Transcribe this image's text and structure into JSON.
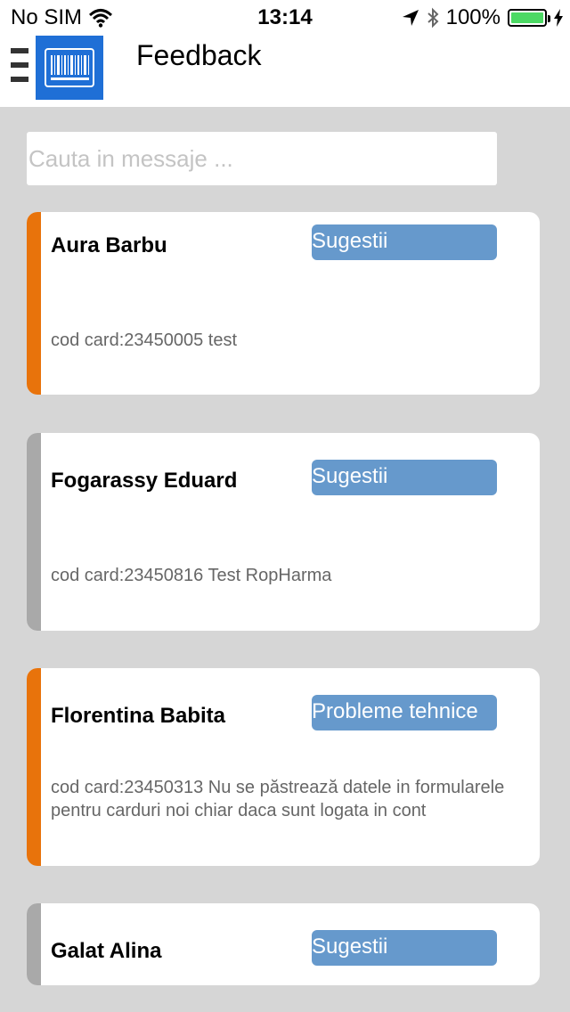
{
  "status_bar": {
    "carrier": "No SIM",
    "time": "13:14",
    "battery": "100%",
    "icons": [
      "wifi-icon",
      "location-arrow-icon",
      "bluetooth-icon",
      "battery-icon",
      "charging-bolt-icon"
    ]
  },
  "header": {
    "title": "Feedback",
    "menu_icon": "hamburger-menu-icon",
    "logo_icon": "barcode-card-icon"
  },
  "search": {
    "placeholder": "Cauta in messaje ..."
  },
  "colors": {
    "accent_orange": "#e8730b",
    "accent_gray": "#a9a9a9",
    "tag_blue": "#6699cc",
    "background": "#d6d6d6"
  },
  "messages": [
    {
      "name": "Aura Barbu",
      "category": "Sugestii",
      "message": "cod card:23450005  test",
      "accent": "#e8730b"
    },
    {
      "name": "Fogarassy Eduard",
      "category": "Sugestii",
      "message": "cod card:23450816  Test RopHarma",
      "accent": "#a9a9a9"
    },
    {
      "name": "Florentina Babita",
      "category": "Probleme tehnice",
      "message": "cod card:23450313  Nu se păstrează datele in formularele pentru carduri noi chiar daca sunt logata in cont",
      "accent": "#e8730b"
    },
    {
      "name": "Galat Alina",
      "category": "Sugestii",
      "message": "",
      "accent": "#a9a9a9"
    }
  ]
}
